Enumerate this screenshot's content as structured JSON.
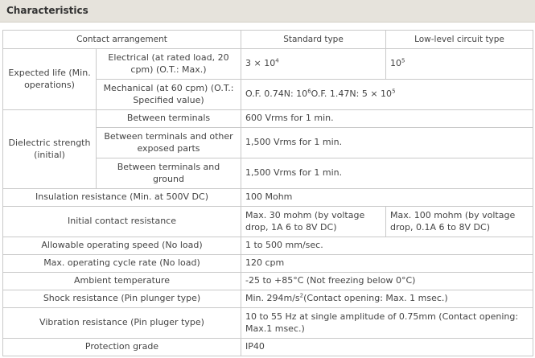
{
  "section": {
    "title": "Characteristics"
  },
  "columns": {
    "contact_arrangement": "Contact arrangement",
    "standard_type": "Standard type",
    "low_level": "Low-level circuit type"
  },
  "expected_life": {
    "label": "Expected life (Min. operations)",
    "electrical_label": "Electrical (at rated load, 20 cpm) (O.T.: Max.)",
    "electrical_std_base": "3 × 10",
    "electrical_std_exp": "4",
    "electrical_low_base": "10",
    "electrical_low_exp": "5",
    "mechanical_label": "Mechanical (at 60 cpm) (O.T.: Specified value)",
    "mechanical_a": "O.F. 0.74N: 10",
    "mechanical_a_exp": "6",
    "mechanical_b": "O.F. 1.47N: 5 × 10",
    "mechanical_b_exp": "5"
  },
  "dielectric": {
    "label": "Dielectric strength (initial)",
    "terminals_label": "Between terminals",
    "terminals_value": "600 Vrms for 1 min.",
    "exposed_label": "Between terminals and other exposed parts",
    "exposed_value": "1,500 Vrms for 1 min.",
    "ground_label": "Between terminals and ground",
    "ground_value": "1,500 Vrms for 1 min."
  },
  "insulation": {
    "label": "Insulation resistance (Min. at 500V DC)",
    "value": "100 Mohm"
  },
  "contact_resistance": {
    "label": "Initial contact resistance",
    "std_value": "Max. 30 mohm (by voltage drop, 1A 6 to 8V DC)",
    "low_value": "Max. 100 mohm (by voltage drop, 0.1A 6 to 8V DC)"
  },
  "operating_speed": {
    "label": "Allowable operating speed (No load)",
    "value": "1 to 500 mm/sec."
  },
  "cycle_rate": {
    "label": "Max. operating cycle rate (No load)",
    "value": "120 cpm"
  },
  "ambient": {
    "label": "Ambient temperature",
    "value": "-25 to +85°C (Not freezing below 0°C)"
  },
  "shock": {
    "label": "Shock resistance (Pin plunger type)",
    "value_a": "Min. 294m/s",
    "value_exp": "2",
    "value_b": "(Contact opening: Max. 1 msec.)"
  },
  "vibration": {
    "label": "Vibration resistance (Pin pluger type)",
    "value": "10 to 55 Hz at single amplitude of 0.75mm (Contact opening: Max.1 msec.)"
  },
  "protection": {
    "label": "Protection grade",
    "value": "IP40"
  }
}
